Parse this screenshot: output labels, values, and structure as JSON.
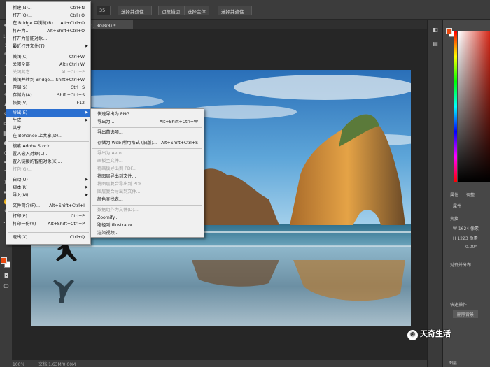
{
  "options_bar": {
    "field1": "35",
    "btn_select": "选择并遮住...",
    "btn_frame": "边框描边...",
    "btn_select_subject": "选择主体",
    "btn_select_mask": "选择并遮住..."
  },
  "document_tab": {
    "label": "绘图 1, RGB/8) *"
  },
  "file_menu": {
    "items": [
      {
        "label": "新建(N)...",
        "shortcut": "Ctrl+N",
        "disabled": false
      },
      {
        "label": "打开(O)...",
        "shortcut": "Ctrl+O",
        "disabled": false
      },
      {
        "label": "在 Bridge 中浏览(B)...",
        "shortcut": "Alt+Ctrl+O",
        "disabled": false
      },
      {
        "label": "打开为...",
        "shortcut": "Alt+Shift+Ctrl+O",
        "disabled": false
      },
      {
        "label": "打开为智能对象...",
        "shortcut": "",
        "disabled": false
      },
      {
        "label": "最近打开文件(T)",
        "shortcut": "",
        "disabled": false,
        "submenu": true
      },
      {
        "label": "关闭(C)",
        "shortcut": "Ctrl+W",
        "disabled": false
      },
      {
        "label": "关闭全部",
        "shortcut": "Alt+Ctrl+W",
        "disabled": false
      },
      {
        "label": "关闭其它",
        "shortcut": "Alt+Ctrl+P",
        "disabled": true
      },
      {
        "label": "关闭并转到 Bridge...",
        "shortcut": "Shift+Ctrl+W",
        "disabled": false
      },
      {
        "label": "存储(S)",
        "shortcut": "Ctrl+S",
        "disabled": false
      },
      {
        "label": "存储为(A)...",
        "shortcut": "Shift+Ctrl+S",
        "disabled": false
      },
      {
        "label": "恢复(V)",
        "shortcut": "F12",
        "disabled": false
      },
      {
        "label": "导出(E)",
        "shortcut": "",
        "disabled": false,
        "submenu": true,
        "highlighted": true
      },
      {
        "label": "生成",
        "shortcut": "",
        "disabled": false,
        "submenu": true
      },
      {
        "label": "共享...",
        "shortcut": "",
        "disabled": false
      },
      {
        "label": "在 Behance 上共享(D)...",
        "shortcut": "",
        "disabled": false
      },
      {
        "label": "搜索 Adobe Stock...",
        "shortcut": "",
        "disabled": false
      },
      {
        "label": "置入嵌入对象(L)...",
        "shortcut": "",
        "disabled": false
      },
      {
        "label": "置入链接的智能对象(K)...",
        "shortcut": "",
        "disabled": false
      },
      {
        "label": "打包(G)...",
        "shortcut": "",
        "disabled": true
      },
      {
        "label": "自动(U)",
        "shortcut": "",
        "disabled": false,
        "submenu": true
      },
      {
        "label": "脚本(R)",
        "shortcut": "",
        "disabled": false,
        "submenu": true
      },
      {
        "label": "导入(M)",
        "shortcut": "",
        "disabled": false,
        "submenu": true
      },
      {
        "label": "文件简介(F)...",
        "shortcut": "Alt+Shift+Ctrl+I",
        "disabled": false
      },
      {
        "label": "打印(P)...",
        "shortcut": "Ctrl+P",
        "disabled": false
      },
      {
        "label": "打印一份(Y)",
        "shortcut": "Alt+Shift+Ctrl+P",
        "disabled": false
      },
      {
        "label": "退出(X)",
        "shortcut": "Ctrl+Q",
        "disabled": false
      }
    ]
  },
  "export_menu": {
    "items": [
      {
        "label": "快速导出为 PNG",
        "shortcut": "",
        "disabled": false
      },
      {
        "label": "导出为...",
        "shortcut": "Alt+Shift+Ctrl+W",
        "disabled": false
      },
      {
        "label": "导出首选项...",
        "shortcut": "",
        "disabled": false
      },
      {
        "label": "存储为 Web 所用格式 (旧版)...",
        "shortcut": "Alt+Shift+Ctrl+S",
        "disabled": false
      },
      {
        "label": "导出为 Aero...",
        "shortcut": "",
        "disabled": true
      },
      {
        "label": "画板至文件...",
        "shortcut": "",
        "disabled": true
      },
      {
        "label": "将画板导出到 PDF...",
        "shortcut": "",
        "disabled": true
      },
      {
        "label": "将图层导出到文件...",
        "shortcut": "",
        "disabled": false
      },
      {
        "label": "将图层复合导出到 PDF...",
        "shortcut": "",
        "disabled": true
      },
      {
        "label": "图层复合导出到文件...",
        "shortcut": "",
        "disabled": true
      },
      {
        "label": "颜色查找表...",
        "shortcut": "",
        "disabled": false
      },
      {
        "label": "数据组作为文件(D)...",
        "shortcut": "",
        "disabled": true
      },
      {
        "label": "Zoomify...",
        "shortcut": "",
        "disabled": false
      },
      {
        "label": "路径到 Illustrator...",
        "shortcut": "",
        "disabled": false
      },
      {
        "label": "渲染视频...",
        "shortcut": "",
        "disabled": false
      }
    ]
  },
  "panels": {
    "tab_properties": "属性",
    "tab_adjust": "调整",
    "section_transform": "变换",
    "w_value": "W 1624 像素",
    "h_value": "H 1223 像素",
    "angle_value": "0.00°",
    "section_align": "对齐并分布",
    "section_quick": "快速操作",
    "btn_remove_bg": "删除背景",
    "tab_layers": "图层"
  },
  "status_bar": {
    "zoom": "100%",
    "doc": "文档:1.63M/0.00M"
  },
  "watermark": {
    "text": "天奇生活"
  },
  "colors": {
    "foreground": "#e8490f",
    "background": "#ffffff",
    "menu_highlight": "#2b6fd0"
  }
}
